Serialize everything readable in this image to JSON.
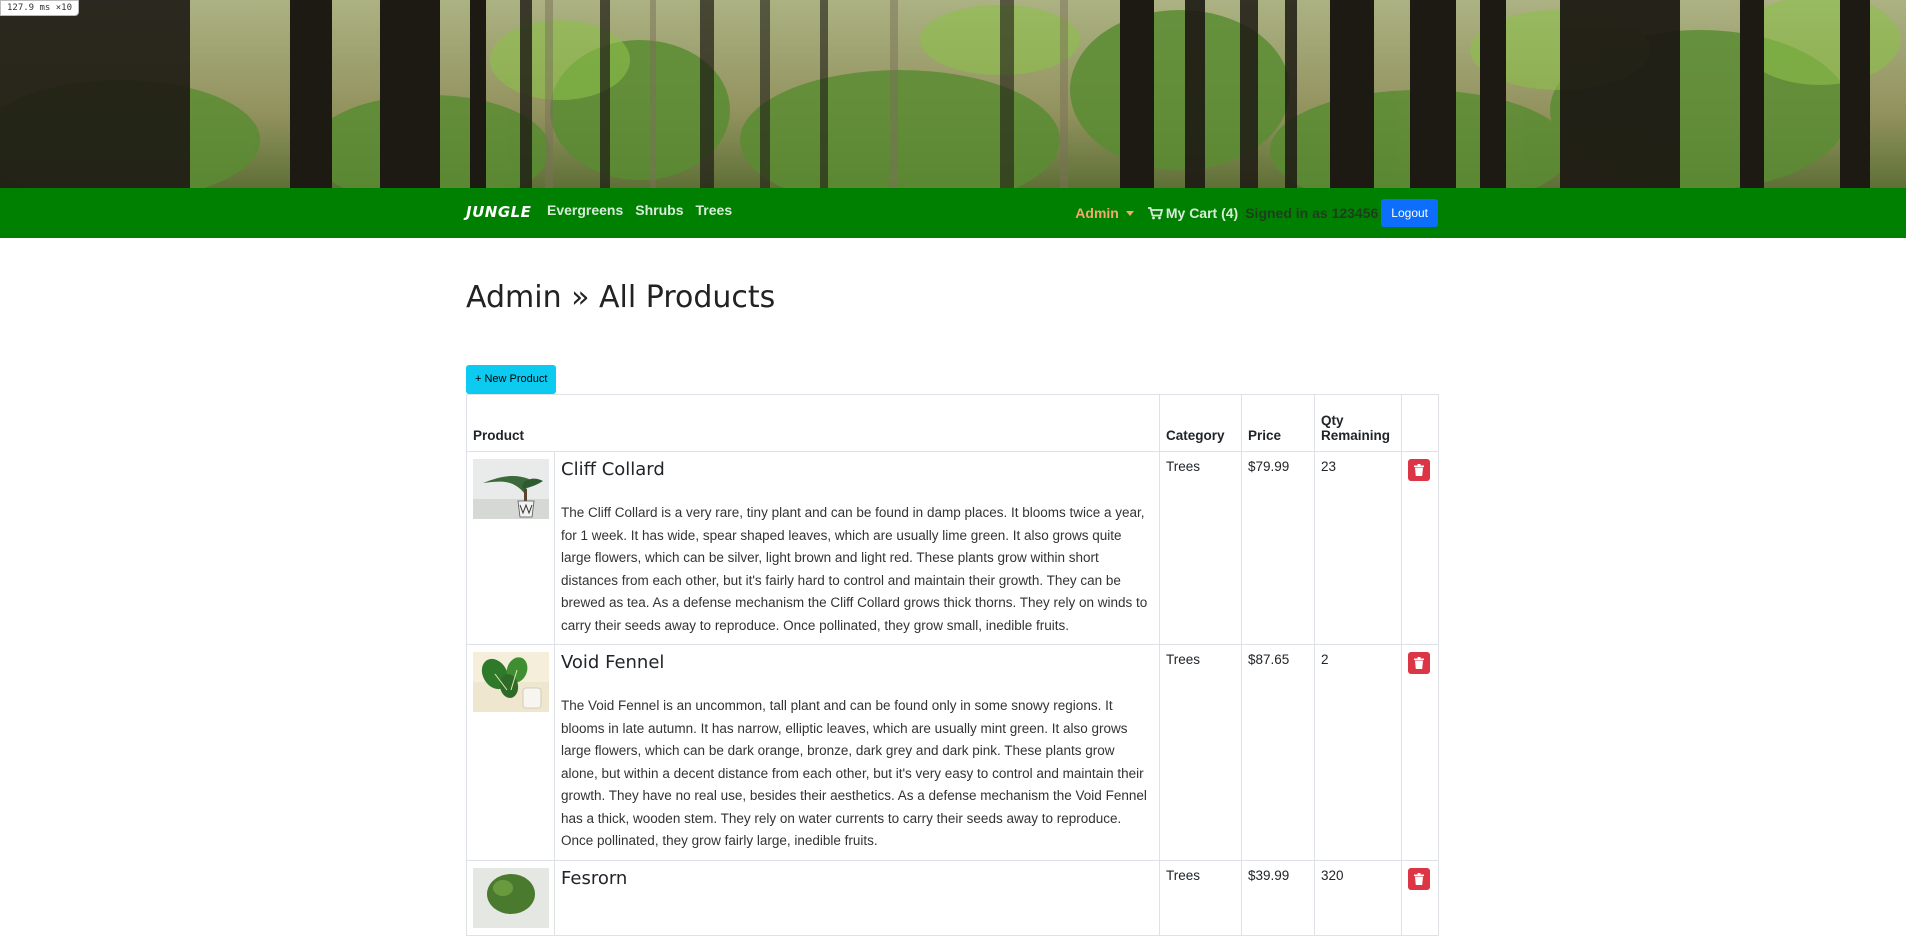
{
  "debug": {
    "perf": "127.9 ms ×10"
  },
  "nav": {
    "brand": "JUNGLE",
    "links": [
      "Evergreens",
      "Shrubs",
      "Trees"
    ],
    "admin_label": "Admin",
    "cart_label": "My Cart (4)",
    "signed_in": "Signed in as 123456",
    "logout_label": "Logout"
  },
  "page": {
    "title": "Admin » All Products",
    "new_product_label": "+ New Product"
  },
  "table": {
    "headers": {
      "product": "Product",
      "category": "Category",
      "price": "Price",
      "qty": "Qty Remaining"
    },
    "rows": [
      {
        "name": "Cliff Collard",
        "description": "The Cliff Collard is a very rare, tiny plant and can be found in damp places. It blooms twice a year, for 1 week. It has wide, spear shaped leaves, which are usually lime green. It also grows quite large flowers, which can be silver, light brown and light red. These plants grow within short distances from each other, but it's fairly hard to control and maintain their growth. They can be brewed as tea. As a defense mechanism the Cliff Collard grows thick thorns. They rely on winds to carry their seeds away to reproduce. Once pollinated, they grow small, inedible fruits.",
        "category": "Trees",
        "price": "$79.99",
        "qty": "23",
        "image_icon": "bonsai-pot-image"
      },
      {
        "name": "Void Fennel",
        "description": "The Void Fennel is an uncommon, tall plant and can be found only in some snowy regions. It blooms in late autumn. It has narrow, elliptic leaves, which are usually mint green. It also grows large flowers, which can be dark orange, bronze, dark grey and dark pink. These plants grow alone, but within a decent distance from each other, but it's very easy to control and maintain their growth. They have no real use, besides their aesthetics. As a defense mechanism the Void Fennel has a thick, wooden stem. They rely on water currents to carry their seeds away to reproduce. Once pollinated, they grow fairly large, inedible fruits.",
        "category": "Trees",
        "price": "$87.65",
        "qty": "2",
        "image_icon": "leafy-plant-image"
      },
      {
        "name": "Fesrorn",
        "description": "",
        "category": "Trees",
        "price": "$39.99",
        "qty": "320",
        "image_icon": "shrub-image"
      }
    ]
  },
  "colors": {
    "navbar": "#008000",
    "admin_accent": "#f4a86c",
    "logout_bg": "#0d6efd",
    "new_btn_bg": "#0dcaf0",
    "delete_bg": "#dc3545"
  }
}
